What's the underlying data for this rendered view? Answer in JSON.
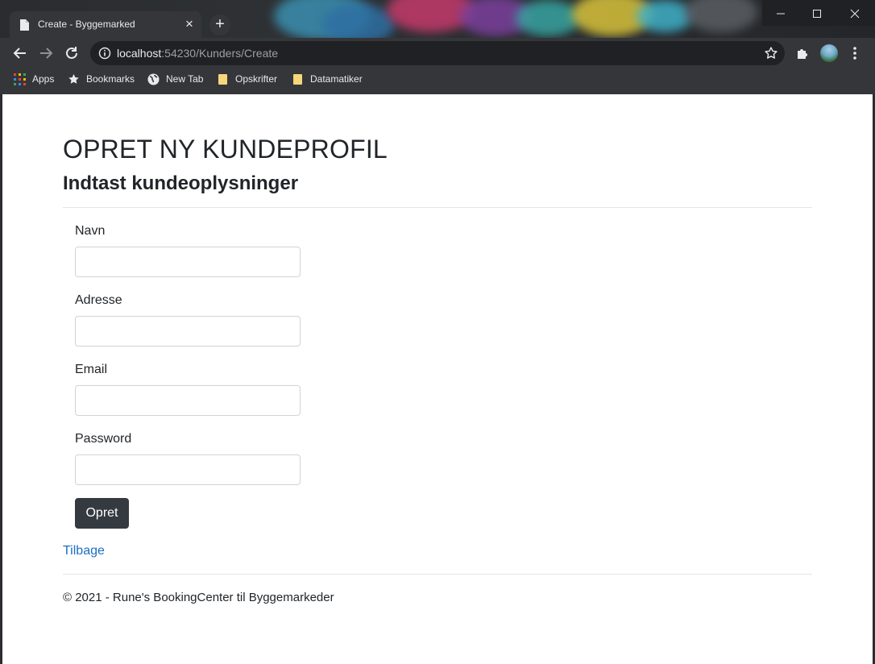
{
  "browser": {
    "tab_title": "Create - Byggemarked",
    "url_host": "localhost",
    "url_path": ":54230/Kunders/Create",
    "bookmarks": [
      {
        "label": "Apps",
        "icon": "apps-grid-icon"
      },
      {
        "label": "Bookmarks",
        "icon": "star-icon"
      },
      {
        "label": "New Tab",
        "icon": "globe-icon"
      },
      {
        "label": "Opskrifter",
        "icon": "folder-icon"
      },
      {
        "label": "Datamatiker",
        "icon": "folder-icon"
      }
    ]
  },
  "page": {
    "title": "OPRET NY KUNDEPROFIL",
    "subtitle": "Indtast kundeoplysninger",
    "fields": {
      "navn": {
        "label": "Navn",
        "value": ""
      },
      "adresse": {
        "label": "Adresse",
        "value": ""
      },
      "email": {
        "label": "Email",
        "value": ""
      },
      "password": {
        "label": "Password",
        "value": ""
      }
    },
    "submit_label": "Opret",
    "back_link": "Tilbage",
    "footer": "© 2021 - Rune's BookingCenter til Byggemarkeder"
  },
  "colors": {
    "button_bg": "#343a40",
    "link": "#1b6ec2",
    "text": "#212529"
  }
}
